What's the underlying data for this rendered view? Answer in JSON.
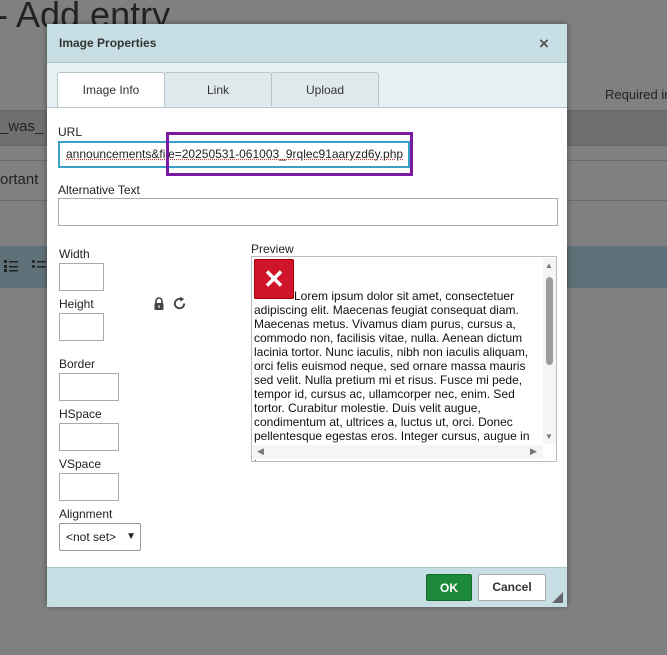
{
  "background": {
    "page_title": "- Add entry",
    "required_text": "Required in",
    "field_was": "_was_",
    "field_ortant": "ortant"
  },
  "dialog": {
    "title": "Image Properties",
    "close_glyph": "×",
    "tabs": [
      {
        "label": "Image Info",
        "active": true
      },
      {
        "label": "Link",
        "active": false
      },
      {
        "label": "Upload",
        "active": false
      }
    ],
    "url": {
      "label": "URL",
      "value": "announcements&file=20250531-061003_9rqlec91aaryzd6y.php"
    },
    "alt_text": {
      "label": "Alternative Text",
      "value": ""
    },
    "width": {
      "label": "Width",
      "value": ""
    },
    "height": {
      "label": "Height",
      "value": ""
    },
    "border": {
      "label": "Border",
      "value": ""
    },
    "hspace": {
      "label": "HSpace",
      "value": ""
    },
    "vspace": {
      "label": "VSpace",
      "value": ""
    },
    "alignment": {
      "label": "Alignment",
      "selected": "<not set>"
    },
    "preview": {
      "label": "Preview",
      "broken_image_glyph": "✕",
      "text": "Lorem ipsum dolor sit amet, consectetuer adipiscing elit. Maecenas feugiat consequat diam. Maecenas metus. Vivamus diam purus, cursus a, commodo non, facilisis vitae, nulla. Aenean dictum lacinia tortor. Nunc iaculis, nibh non iaculis aliquam, orci felis euismod neque, sed ornare massa mauris sed velit. Nulla pretium mi et risus. Fusce mi pede, tempor id, cursus ac, ullamcorper nec, enim. Sed tortor. Curabitur molestie. Duis velit augue, condimentum at, ultrices a, luctus ut, orci. Donec pellentesque egestas eros. Integer cursus, augue in cursus faucibus, eros pede bibendum sem, in tempus"
    },
    "buttons": {
      "ok": "OK",
      "cancel": "Cancel"
    },
    "colors": {
      "ok_green": "#1c8a3a",
      "header_bg": "#c7dfe4",
      "focus_blue": "#3aa0c8",
      "highlight_purple": "#7a1aa2",
      "error_red": "#d0142a"
    }
  }
}
